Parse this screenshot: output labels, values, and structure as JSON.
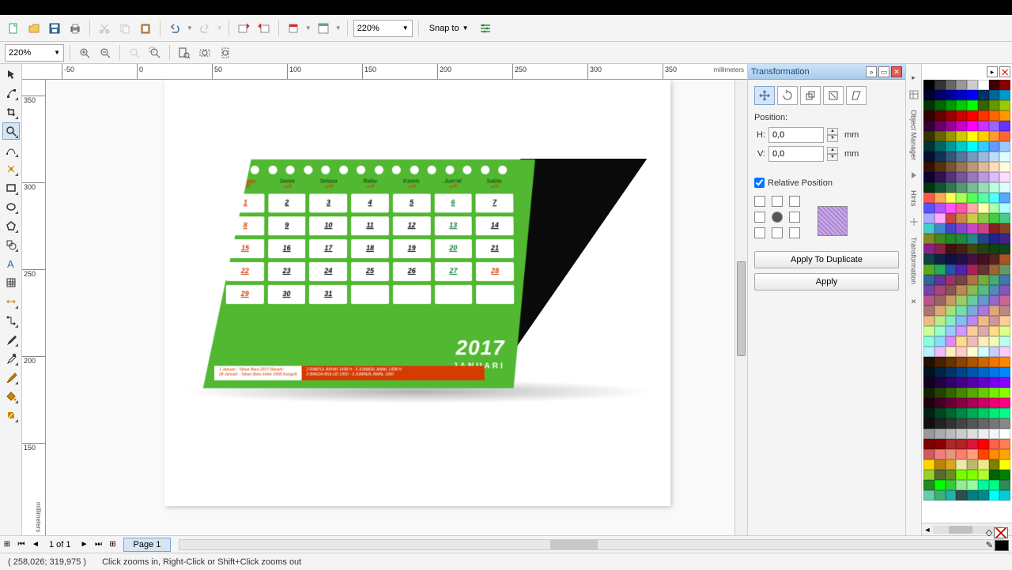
{
  "toolbar": {
    "zoom": "220%",
    "snap": "Snap to"
  },
  "prop": {
    "zoom": "220%"
  },
  "ruler": {
    "unit": "millimeters",
    "h_ticks": [
      -50,
      0,
      50,
      100,
      150,
      200,
      250,
      300,
      350
    ],
    "v_ticks": [
      350,
      300,
      250,
      200,
      150
    ]
  },
  "calendar": {
    "year": "2017",
    "month": "JANUARI",
    "days": [
      "Minggu",
      "Senin",
      "Selasa",
      "Rabu",
      "Kamis",
      "Jum'at",
      "Sabtu"
    ],
    "cells": [
      {
        "n": "1",
        "c": "red"
      },
      {
        "n": "2",
        "c": "black"
      },
      {
        "n": "3",
        "c": "black"
      },
      {
        "n": "4",
        "c": "black"
      },
      {
        "n": "5",
        "c": "black"
      },
      {
        "n": "6",
        "c": "green"
      },
      {
        "n": "7",
        "c": "black"
      },
      {
        "n": "8",
        "c": "red"
      },
      {
        "n": "9",
        "c": "black"
      },
      {
        "n": "10",
        "c": "black"
      },
      {
        "n": "11",
        "c": "black"
      },
      {
        "n": "12",
        "c": "black"
      },
      {
        "n": "13",
        "c": "green"
      },
      {
        "n": "14",
        "c": "black"
      },
      {
        "n": "15",
        "c": "red"
      },
      {
        "n": "16",
        "c": "black"
      },
      {
        "n": "17",
        "c": "black"
      },
      {
        "n": "18",
        "c": "black"
      },
      {
        "n": "19",
        "c": "black"
      },
      {
        "n": "20",
        "c": "green"
      },
      {
        "n": "21",
        "c": "black"
      },
      {
        "n": "22",
        "c": "red"
      },
      {
        "n": "23",
        "c": "black"
      },
      {
        "n": "24",
        "c": "black"
      },
      {
        "n": "25",
        "c": "black"
      },
      {
        "n": "26",
        "c": "black"
      },
      {
        "n": "27",
        "c": "green"
      },
      {
        "n": "28",
        "c": "red"
      },
      {
        "n": "29",
        "c": "red"
      },
      {
        "n": "30",
        "c": "black"
      },
      {
        "n": "31",
        "c": "black"
      },
      {
        "n": "",
        "c": "empty"
      },
      {
        "n": "",
        "c": "empty"
      },
      {
        "n": "",
        "c": "empty"
      },
      {
        "n": "",
        "c": "empty"
      }
    ],
    "info_left": "1 Januari  :  Tahun Baru 2017 Masehi\n28 Januari  :  Tahun Baru Imlek 2568 Kongzili",
    "info_right": "2 RABI'UL AKHIR 1438 H - 3 JUMADIL AWAL 1438 H\n2 BAKDA MULUD 1950 - 3 JUMADIL AWAL 1950"
  },
  "docker": {
    "title": "Transformation",
    "position_label": "Position:",
    "h_label": "H:",
    "v_label": "V:",
    "h_value": "0,0",
    "v_value": "0,0",
    "unit": "mm",
    "relative": "Relative Position",
    "apply_dup": "Apply To Duplicate",
    "apply": "Apply",
    "side_tabs": [
      "Object Manager",
      "Hints",
      "Transformation"
    ]
  },
  "pagebar": {
    "count": "1 of 1",
    "tab": "Page 1"
  },
  "status": {
    "coords": "( 258,026; 319,975 )",
    "hint": "Click zooms in, Right-Click or Shift+Click zooms out"
  },
  "palette_colors": [
    "#000",
    "#333",
    "#666",
    "#999",
    "#ccc",
    "#fff",
    "#400",
    "#800",
    "#003",
    "#006",
    "#009",
    "#00c",
    "#00f",
    "#036",
    "#069",
    "#09c",
    "#030",
    "#060",
    "#090",
    "#0c0",
    "#0f0",
    "#360",
    "#690",
    "#9c0",
    "#300",
    "#600",
    "#900",
    "#c00",
    "#f00",
    "#f30",
    "#f60",
    "#f90",
    "#303",
    "#606",
    "#909",
    "#c0c",
    "#f0f",
    "#c3f",
    "#96f",
    "#63f",
    "#330",
    "#660",
    "#990",
    "#cc0",
    "#ff0",
    "#fc0",
    "#f93",
    "#f63",
    "#033",
    "#066",
    "#099",
    "#0cc",
    "#0ff",
    "#3cf",
    "#69f",
    "#9cf",
    "#013",
    "#135",
    "#357",
    "#579",
    "#79b",
    "#9bd",
    "#bdf",
    "#dff",
    "#310",
    "#531",
    "#753",
    "#975",
    "#b97",
    "#db9",
    "#fdb",
    "#ffd",
    "#103",
    "#315",
    "#537",
    "#759",
    "#97b",
    "#b9d",
    "#dbf",
    "#fdf",
    "#031",
    "#153",
    "#375",
    "#597",
    "#7b9",
    "#9db",
    "#bfd",
    "#dff",
    "#f55",
    "#fa5",
    "#ff5",
    "#af5",
    "#5f5",
    "#5fa",
    "#5ff",
    "#5af",
    "#55f",
    "#a5f",
    "#f5f",
    "#f5a",
    "#faa",
    "#ffa",
    "#afa",
    "#aff",
    "#aaf",
    "#faf",
    "#c44",
    "#c84",
    "#cc4",
    "#8c4",
    "#4c4",
    "#4c8",
    "#4cc",
    "#48c",
    "#44c",
    "#84c",
    "#c4c",
    "#c48",
    "#822",
    "#842",
    "#882",
    "#482",
    "#282",
    "#284",
    "#288",
    "#248",
    "#228",
    "#428",
    "#828",
    "#824",
    "#411",
    "#421",
    "#441",
    "#241",
    "#141",
    "#142",
    "#144",
    "#124",
    "#114",
    "#214",
    "#414",
    "#412",
    "#522",
    "#a52",
    "#5a2",
    "#2a5",
    "#25a",
    "#52a",
    "#a25",
    "#633",
    "#963",
    "#696",
    "#369",
    "#639",
    "#936",
    "#744",
    "#a74",
    "#7a4",
    "#4a7",
    "#47a",
    "#74a",
    "#a47",
    "#855",
    "#b85",
    "#8b5",
    "#5b8",
    "#58b",
    "#85b",
    "#b58",
    "#966",
    "#c96",
    "#9c6",
    "#6c9",
    "#69c",
    "#96c",
    "#c69",
    "#a77",
    "#da7",
    "#ad7",
    "#7da",
    "#7ad",
    "#a7d",
    "#da7",
    "#b88",
    "#eb8",
    "#be8",
    "#8eb",
    "#8be",
    "#b8e",
    "#eb8",
    "#c99",
    "#fc9",
    "#cf9",
    "#9fc",
    "#9cf",
    "#c9f",
    "#fc9",
    "#daa",
    "#fd8",
    "#df8",
    "#8fd",
    "#8df",
    "#d8f",
    "#fd8",
    "#ebb",
    "#feb",
    "#efb",
    "#bfe",
    "#bef",
    "#ebf",
    "#feb",
    "#fcc",
    "#ffc",
    "#cff",
    "#ccf",
    "#fcf",
    "#210",
    "#420",
    "#630",
    "#840",
    "#a50",
    "#c60",
    "#e70",
    "#f80",
    "#012",
    "#024",
    "#036",
    "#048",
    "#05a",
    "#06c",
    "#07e",
    "#08f",
    "#102",
    "#204",
    "#306",
    "#408",
    "#50a",
    "#60c",
    "#70e",
    "#80f",
    "#120",
    "#240",
    "#360",
    "#480",
    "#5a0",
    "#6c0",
    "#7e0",
    "#8f0",
    "#201",
    "#402",
    "#603",
    "#804",
    "#a05",
    "#c06",
    "#e07",
    "#f08",
    "#021",
    "#042",
    "#063",
    "#084",
    "#0a5",
    "#0c6",
    "#0e7",
    "#0f8",
    "#111",
    "#222",
    "#333",
    "#444",
    "#555",
    "#666",
    "#777",
    "#888",
    "#999",
    "#aaa",
    "#bbb",
    "#ccc",
    "#ddd",
    "#eee",
    "#f5f5f5",
    "#fff",
    "#800000",
    "#8b0000",
    "#a52a2a",
    "#b22222",
    "#dc143c",
    "#ff0000",
    "#ff6347",
    "#ff7f50",
    "#cd5c5c",
    "#f08080",
    "#e9967a",
    "#fa8072",
    "#ffa07a",
    "#ff4500",
    "#ff8c00",
    "#ffa500",
    "#ffd700",
    "#b8860b",
    "#daa520",
    "#eee8aa",
    "#bdb76b",
    "#f0e68c",
    "#808000",
    "#ffff00",
    "#9acd32",
    "#556b2f",
    "#6b8e23",
    "#7cfc00",
    "#7fff00",
    "#adff2f",
    "#006400",
    "#008000",
    "#228b22",
    "#00ff00",
    "#32cd32",
    "#90ee90",
    "#98fb98",
    "#00fa9a",
    "#00ff7f",
    "#2e8b57",
    "#66cdaa",
    "#3cb371",
    "#20b2aa",
    "#2f4f4f",
    "#008080",
    "#008b8b",
    "#00ffff",
    "#00ced1"
  ]
}
